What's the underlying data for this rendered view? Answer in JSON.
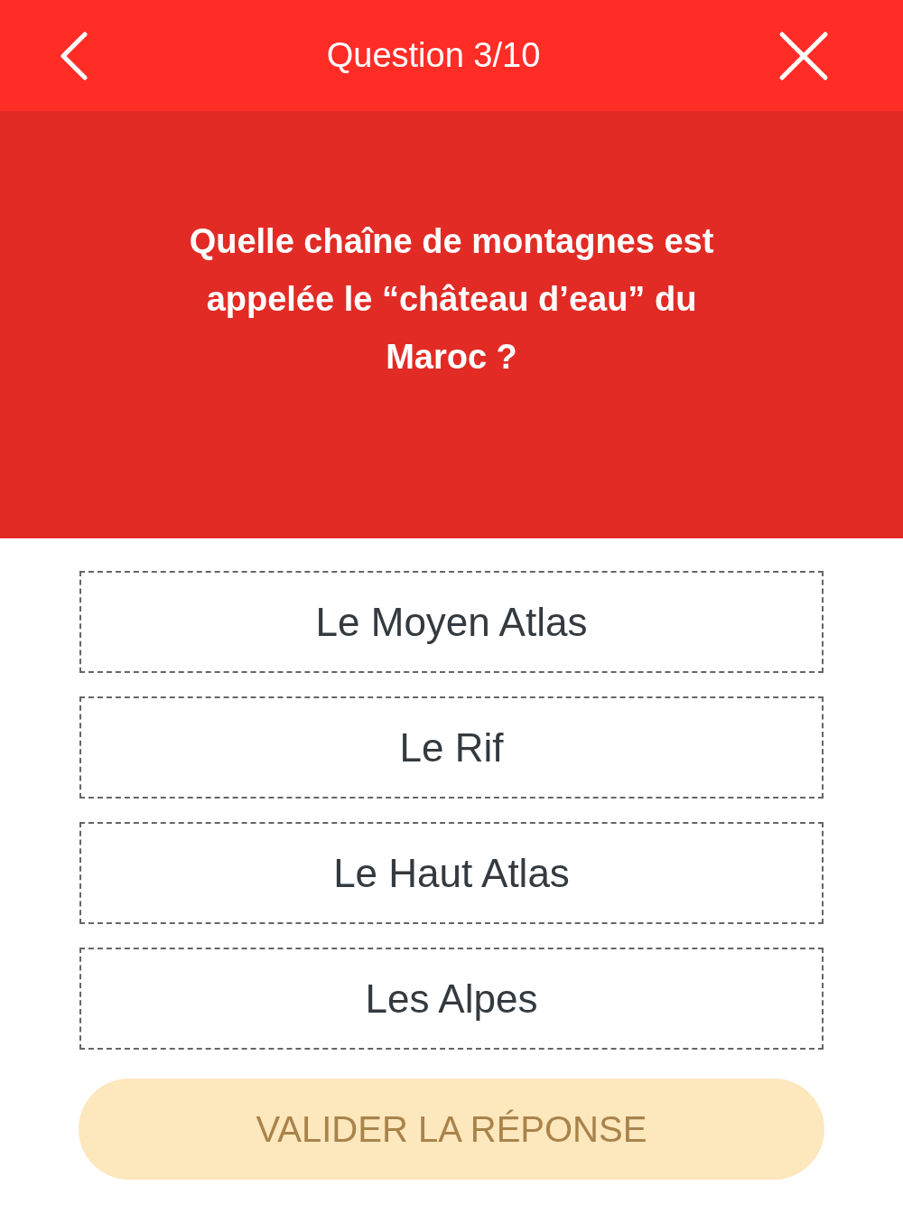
{
  "header": {
    "title": "Question 3/10"
  },
  "question": {
    "text": "Quelle chaîne de montagnes est appelée le “château d’eau” du Maroc ?"
  },
  "answers": [
    {
      "label": "Le Moyen Atlas",
      "selected": false
    },
    {
      "label": "Le Rif",
      "selected": false
    },
    {
      "label": "Le Haut Atlas",
      "selected": false
    },
    {
      "label": "Les Alpes",
      "selected": false
    }
  ],
  "submit": {
    "label": "VALIDER LA RÉPONSE",
    "disabled": true
  }
}
